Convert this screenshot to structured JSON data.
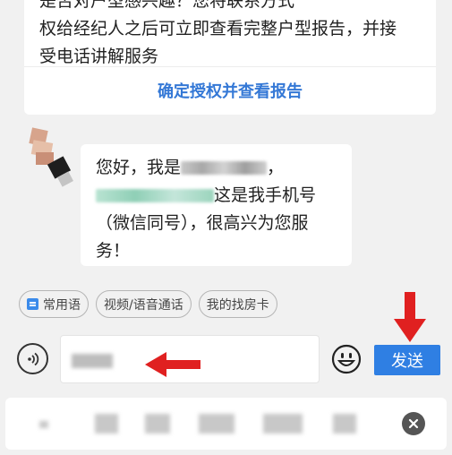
{
  "auth_card": {
    "partial_line": "是否对户型感兴趣？您将联系方式",
    "line2_prefix": "权给经纪人之后可立即查看完整户型报告，并接",
    "line3": "受电话讲解服务",
    "action_label": "确定授权并查看报告"
  },
  "agent_message": {
    "greeting": "您好，我是",
    "comma": "，",
    "phone_suffix": "这是我手机号",
    "line3": "（微信同号），很高兴为您服",
    "line4": "务！"
  },
  "quick_replies": [
    {
      "label": "常用语",
      "icon": "book-icon"
    },
    {
      "label": "视频/语音通话"
    },
    {
      "label": "我的找房卡"
    }
  ],
  "composer": {
    "voice_icon": "voice-icon",
    "emoji_icon": "smiley-icon",
    "send_label": "发送"
  },
  "suggestions": {
    "clear_icon": "close-circle-icon"
  },
  "colors": {
    "accent": "#2f7fe3",
    "link": "#3478d6",
    "annotation_arrow": "#e02020",
    "background": "#f1f1f1"
  }
}
